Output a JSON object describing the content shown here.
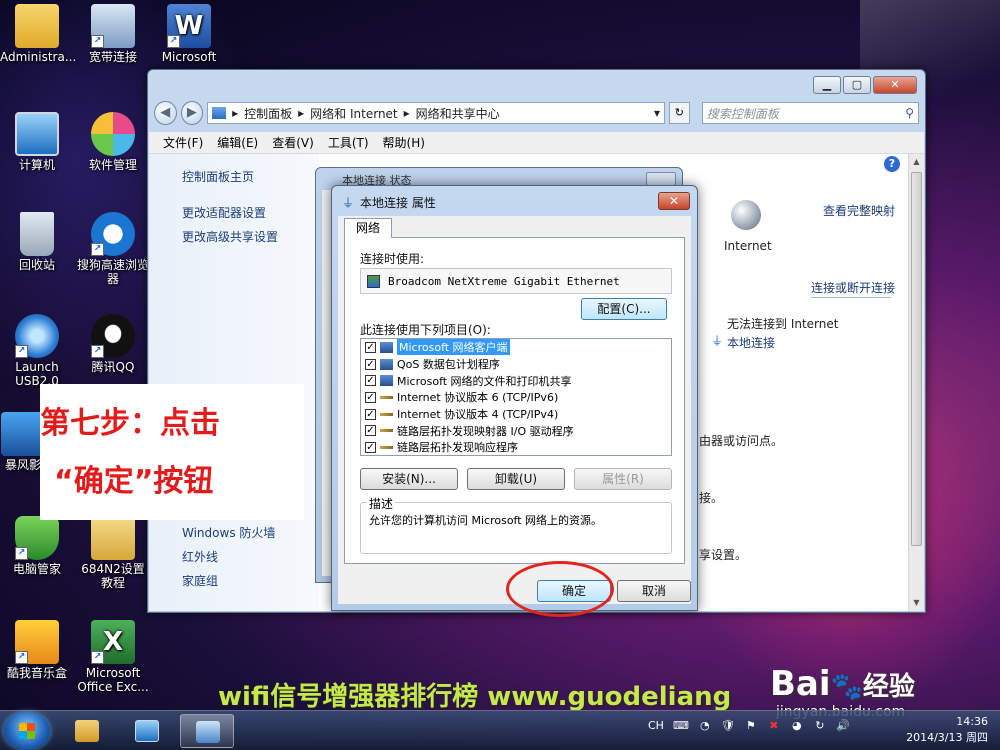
{
  "desktop": {
    "icons": [
      {
        "label": "Administra..."
      },
      {
        "label": "宽带连接"
      },
      {
        "label": "Microsoft"
      },
      {
        "label": "计算机"
      },
      {
        "label": "软件管理"
      },
      {
        "label": "回收站"
      },
      {
        "label": "搜狗高速浏览器"
      },
      {
        "label": "Launch USB2.0"
      },
      {
        "label": "腾讯QQ"
      },
      {
        "label": "暴风影"
      },
      {
        "label": "电脑管家"
      },
      {
        "label": "684N2设置教程"
      },
      {
        "label": "酷我音乐盒"
      },
      {
        "label": "Microsoft Office Exc..."
      }
    ]
  },
  "explorer": {
    "breadcrumb": [
      "控制面板",
      "网络和 Internet",
      "网络和共享中心"
    ],
    "search_placeholder": "搜索控制面板",
    "menu": [
      "文件(F)",
      "编辑(E)",
      "查看(V)",
      "工具(T)",
      "帮助(H)"
    ],
    "left_links": [
      "控制面板主页",
      "更改适配器设置",
      "更改高级共享设置",
      "Windows 防火墙",
      "红外线",
      "家庭组"
    ],
    "right": {
      "view_full_map": "查看完整映射",
      "internet_label": "Internet",
      "connect_disconnect": "连接或断开连接",
      "no_internet": "无法连接到 Internet",
      "local_connection": "本地连接",
      "frag1": "由器或访问点。",
      "frag2": "接。",
      "frag3": "享设置。"
    },
    "back_dialog_title": "本地连接 状态"
  },
  "dialog": {
    "title": "本地连接 属性",
    "tab": "网络",
    "connect_using_label": "连接时使用:",
    "adapter": "Broadcom NetXtreme Gigabit Ethernet",
    "configure_btn": "配置(C)...",
    "items_label": "此连接使用下列项目(O):",
    "items": [
      {
        "label": "Microsoft 网络客户端",
        "checked": true,
        "selected": true
      },
      {
        "label": "QoS 数据包计划程序",
        "checked": true,
        "selected": false
      },
      {
        "label": "Microsoft 网络的文件和打印机共享",
        "checked": true,
        "selected": false
      },
      {
        "label": "Internet 协议版本 6 (TCP/IPv6)",
        "checked": true,
        "selected": false
      },
      {
        "label": "Internet 协议版本 4 (TCP/IPv4)",
        "checked": true,
        "selected": false
      },
      {
        "label": "链路层拓扑发现映射器 I/O 驱动程序",
        "checked": true,
        "selected": false
      },
      {
        "label": "链路层拓扑发现响应程序",
        "checked": true,
        "selected": false
      }
    ],
    "install_btn": "安装(N)...",
    "uninstall_btn": "卸载(U)",
    "properties_btn": "属性(R)",
    "desc_legend": "描述",
    "desc_text": "允许您的计算机访问 Microsoft 网络上的资源。",
    "ok_btn": "确定",
    "cancel_btn": "取消"
  },
  "overlay": {
    "line1": "第七步：点击",
    "line2": "“确定”按钮"
  },
  "watermark": {
    "banner": "wifi信号增强器排行榜 www.guodeliang",
    "baidu": "Bai",
    "baidu_jy": "经验",
    "jingyan": "jingyan.baidu.com"
  },
  "taskbar": {
    "lang": "CH",
    "time": "14:36",
    "date": "2014/3/13 周四"
  },
  "colors": {
    "accent_red": "#e41b1b",
    "selection": "#3399ff",
    "banner_green": "#c5e84a"
  }
}
